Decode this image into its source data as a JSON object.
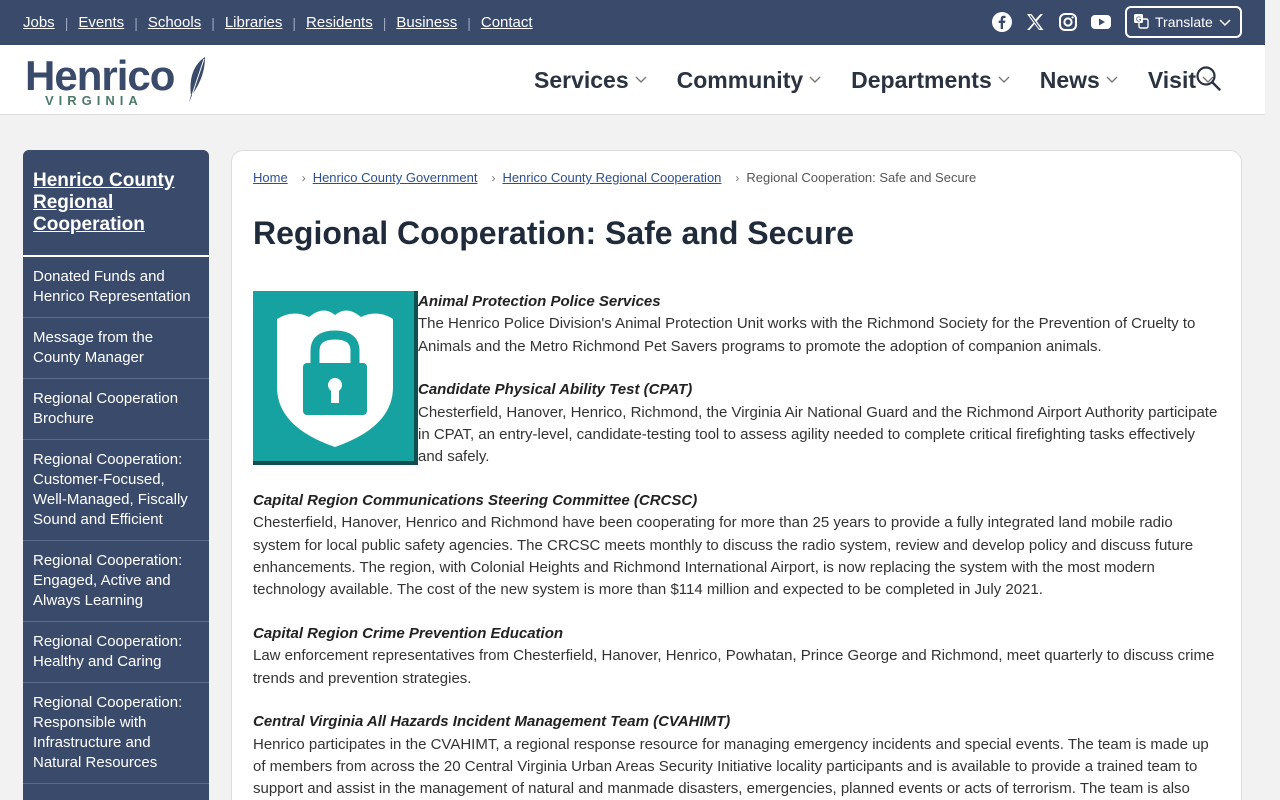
{
  "topbar": {
    "links": [
      "Jobs",
      "Events",
      "Schools",
      "Libraries",
      "Residents",
      "Business",
      "Contact"
    ],
    "social": [
      "facebook-icon",
      "x-icon",
      "instagram-icon",
      "youtube-icon"
    ],
    "translate_label": "Translate"
  },
  "header": {
    "logo_word": "Henrico",
    "logo_sub": "VIRGINIA",
    "nav": [
      "Services",
      "Community",
      "Departments",
      "News",
      "Visit"
    ]
  },
  "sidebar": {
    "title": "Henrico County Regional Cooperation",
    "items": [
      "Donated Funds and Henrico Representation",
      "Message from the County Manager",
      "Regional Cooperation Brochure",
      "Regional Cooperation: Customer-Focused, Well-Managed, Fiscally Sound and Efficient",
      "Regional Cooperation: Engaged, Active and Always Learning",
      "Regional Cooperation: Healthy and Caring",
      "Regional Cooperation: Responsible with Infrastructure and Natural Resources"
    ]
  },
  "breadcrumb": {
    "items": [
      "Home",
      "Henrico County Government",
      "Henrico County Regional Cooperation"
    ],
    "current": "Regional Cooperation: Safe and Secure"
  },
  "page": {
    "title": "Regional Cooperation: Safe and Secure",
    "sections": [
      {
        "heading": "Animal Protection Police Services",
        "text": "The Henrico Police Division's Animal Protection Unit works with the Richmond Society for the Prevention of Cruelty to Animals and the Metro Richmond Pet Savers programs to promote the adoption of companion animals."
      },
      {
        "heading": "Candidate Physical Ability Test (CPAT)",
        "text": "Chesterfield, Hanover, Henrico, Richmond, the Virginia Air National Guard and the Richmond Airport Authority participate in CPAT, an entry-level, candidate-testing tool to assess agility needed to complete critical firefighting tasks effectively and safely."
      },
      {
        "heading": "Capital Region Communications Steering Committee (CRCSC)",
        "text": "Chesterfield, Hanover, Henrico and Richmond have been cooperating for more than 25 years to provide a fully integrated land mobile radio system for local public safety agencies. The CRCSC meets monthly to discuss the radio system, review and develop policy and discuss future enhancements. The region, with Colonial Heights and Richmond International Airport, is now replacing the system with the most modern technology available. The cost of the new system is more than $114 million and expected to be completed in July 2021."
      },
      {
        "heading": "Capital Region Crime Prevention Education",
        "text": "Law enforcement representatives from Chesterfield, Hanover, Henrico, Powhatan, Prince George and Richmond, meet quarterly to discuss crime trends and prevention strategies."
      },
      {
        "heading": "Central Virginia All Hazards Incident Management Team (CVAHIMT)",
        "text": "Henrico participates in the CVAHIMT, a regional response resource for managing emergency incidents and special events. The team is made up of members from across the 20 Central Virginia Urban Areas Security Initiative locality participants and is available to provide a trained team to support and assist in the management of natural and manmade disasters, emergencies, planned events or acts of terrorism. The team is also"
      }
    ]
  },
  "colors": {
    "navy": "#3a4a6b",
    "teal": "#17a2a2",
    "link": "#2d4f8f"
  }
}
